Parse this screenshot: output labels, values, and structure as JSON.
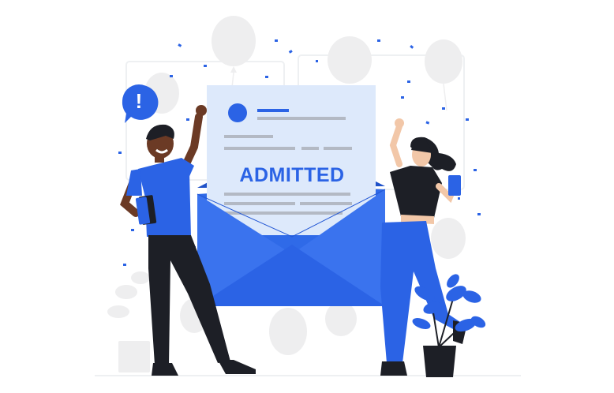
{
  "letter": {
    "headline": "ADMITTED"
  },
  "alert_badge": {
    "symbol": "!"
  },
  "colors": {
    "primary_blue": "#2b63e5",
    "envelope_blue": "#2f6ae8",
    "envelope_shadow": "#1f52c9",
    "paper": "#dde9fb",
    "paper_lines": "#b3b9c4",
    "skin_dark": "#6b3a25",
    "skin_light": "#f2c7a8",
    "clothes_dark": "#1d1f26",
    "balloon_grey": "#eeeeef"
  },
  "icons": [
    "alert-badge-icon",
    "avatar-dot-icon",
    "balloon-icon",
    "confetti-icon",
    "book-icon",
    "potted-plant-icon"
  ]
}
